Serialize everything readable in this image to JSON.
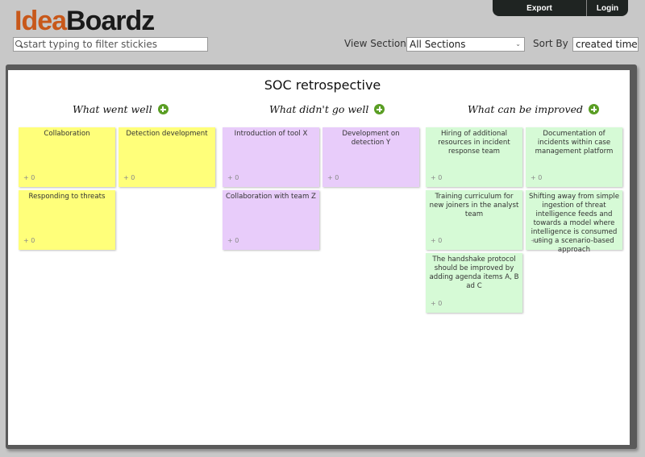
{
  "app": {
    "logo_part1": "Idea",
    "logo_part2": "Boardz"
  },
  "topnav": {
    "export_label": "Export",
    "login_label": "Login"
  },
  "filter": {
    "placeholder": "start typing to filter stickies",
    "value": ""
  },
  "controls": {
    "view_section_label": "View Section",
    "view_section_value": "All Sections",
    "sort_by_label": "Sort By",
    "sort_by_value": "created time"
  },
  "board": {
    "title": "SOC retrospective",
    "sections": [
      {
        "title": "What went well",
        "color": "#ffff7a",
        "stickies": [
          {
            "text": "Collaboration",
            "votes": "+ 0"
          },
          {
            "text": "Detection development",
            "votes": "+ 0"
          },
          {
            "text": "Responding to threats",
            "votes": "+ 0"
          }
        ]
      },
      {
        "title": "What didn't go well",
        "color": "#e8ccfa",
        "stickies": [
          {
            "text": "Introduction of tool X",
            "votes": "+ 0"
          },
          {
            "text": "Development on detection Y",
            "votes": "+ 0"
          },
          {
            "text": "Collaboration with team Z",
            "votes": "+ 0"
          }
        ]
      },
      {
        "title": "What can be improved",
        "color": "#d6fad6",
        "stickies": [
          {
            "text": "Hiring of additional resources in incident response team",
            "votes": "+ 0"
          },
          {
            "text": "Documentation of incidents within case management platform",
            "votes": "+ 0"
          },
          {
            "text": "Training curriculum for new joiners in the analyst team",
            "votes": "+ 0"
          },
          {
            "text": "Shifting away from simple ingestion of threat intelligence feeds and towards a model where intelligence is consumed using a scenario-based approach",
            "votes": "+ 0"
          },
          {
            "text": "The handshake protocol should be improved by adding agenda items A, B ad C",
            "votes": "+ 0"
          }
        ]
      }
    ]
  }
}
